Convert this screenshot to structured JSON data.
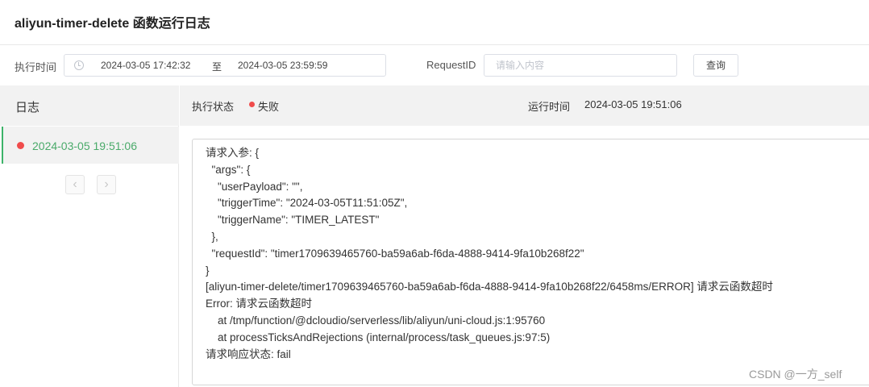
{
  "header": {
    "title": "aliyun-timer-delete 函数运行日志"
  },
  "filter": {
    "time_label": "执行时间",
    "start": "2024-03-05 17:42:32",
    "separator": "至",
    "end": "2024-03-05 23:59:59",
    "request_label": "RequestID",
    "request_placeholder": "请输入内容",
    "query_button": "查询"
  },
  "sidebar": {
    "title": "日志",
    "items": [
      {
        "label": "2024-03-05 19:51:06",
        "status_color": "#f04c4c"
      }
    ],
    "prev": "‹",
    "next": "›"
  },
  "detail": {
    "status_label": "执行状态",
    "status_value": "失败",
    "status_color": "#f04c4c",
    "runtime_label": "运行时间",
    "runtime_value": "2024-03-05 19:51:06"
  },
  "log_lines": [
    "请求入参: {",
    "  \"args\": {",
    "    \"userPayload\": \"\",",
    "    \"triggerTime\": \"2024-03-05T11:51:05Z\",",
    "    \"triggerName\": \"TIMER_LATEST\"",
    "  },",
    "  \"requestId\": \"timer1709639465760-ba59a6ab-f6da-4888-9414-9fa10b268f22\"",
    "}",
    "[aliyun-timer-delete/timer1709639465760-ba59a6ab-f6da-4888-9414-9fa10b268f22/6458ms/ERROR] 请求云函数超时",
    "Error: 请求云函数超时",
    "    at /tmp/function/@dcloudio/serverless/lib/aliyun/uni-cloud.js:1:95760",
    "    at processTicksAndRejections (internal/process/task_queues.js:97:5)",
    "请求响应状态: fail"
  ],
  "watermark": "CSDN @一方_self"
}
